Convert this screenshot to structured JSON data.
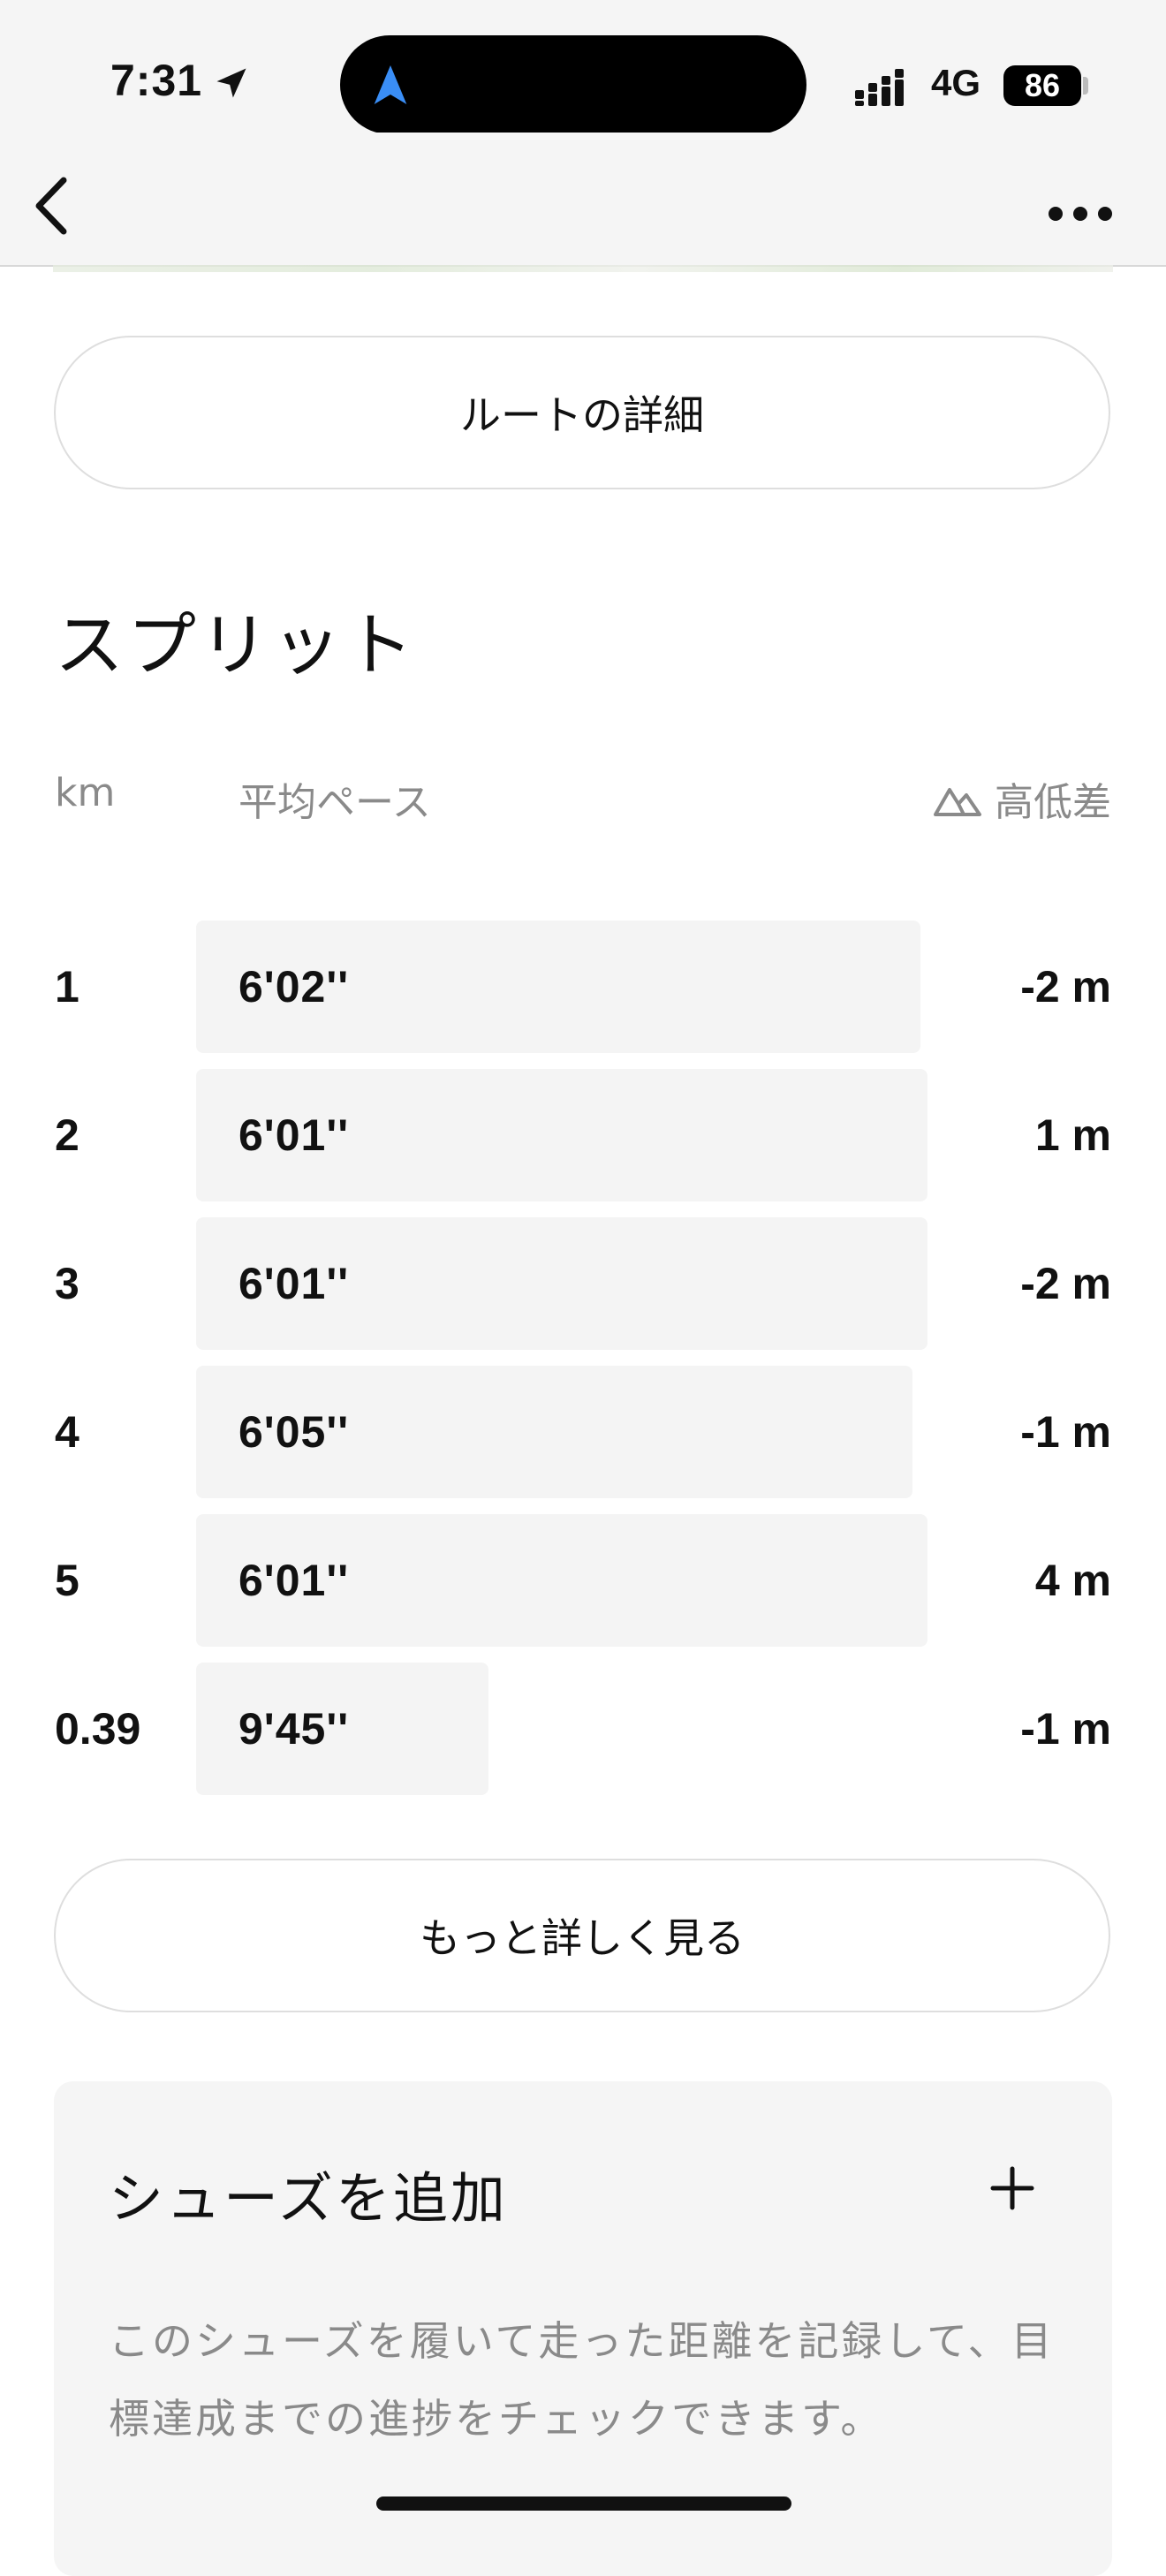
{
  "status_bar": {
    "time": "7:31",
    "network": "4G",
    "battery": "86"
  },
  "nav": {
    "back_icon": "chevron-left-icon",
    "more_icon": "ellipsis-icon"
  },
  "route_button": {
    "label": "ルートの詳細"
  },
  "splits": {
    "title": "スプリット",
    "headers": {
      "km": "km",
      "pace": "平均ペース",
      "elevation": "高低差"
    },
    "rows": [
      {
        "km": "1",
        "pace": "6'02''",
        "elevation": "-2 m",
        "bar_fraction": 0.99
      },
      {
        "km": "2",
        "pace": "6'01''",
        "elevation": "1 m",
        "bar_fraction": 1.0
      },
      {
        "km": "3",
        "pace": "6'01''",
        "elevation": "-2 m",
        "bar_fraction": 1.0
      },
      {
        "km": "4",
        "pace": "6'05''",
        "elevation": "-1 m",
        "bar_fraction": 0.98
      },
      {
        "km": "5",
        "pace": "6'01''",
        "elevation": "4 m",
        "bar_fraction": 1.0
      },
      {
        "km": "0.39",
        "pace": "9'45''",
        "elevation": "-1 m",
        "bar_fraction": 0.4
      }
    ]
  },
  "more_button": {
    "label": "もっと詳しく見る"
  },
  "shoes": {
    "title": "シューズを追加",
    "plus_icon": "plus-icon",
    "description": "このシューズを履いて走った距離を記録して、目標達成までの進捗をチェックできます。"
  },
  "colors": {
    "accent": "#3a8ef6",
    "bar": "#f4f4f4",
    "muted_text": "#8a8a8a"
  }
}
